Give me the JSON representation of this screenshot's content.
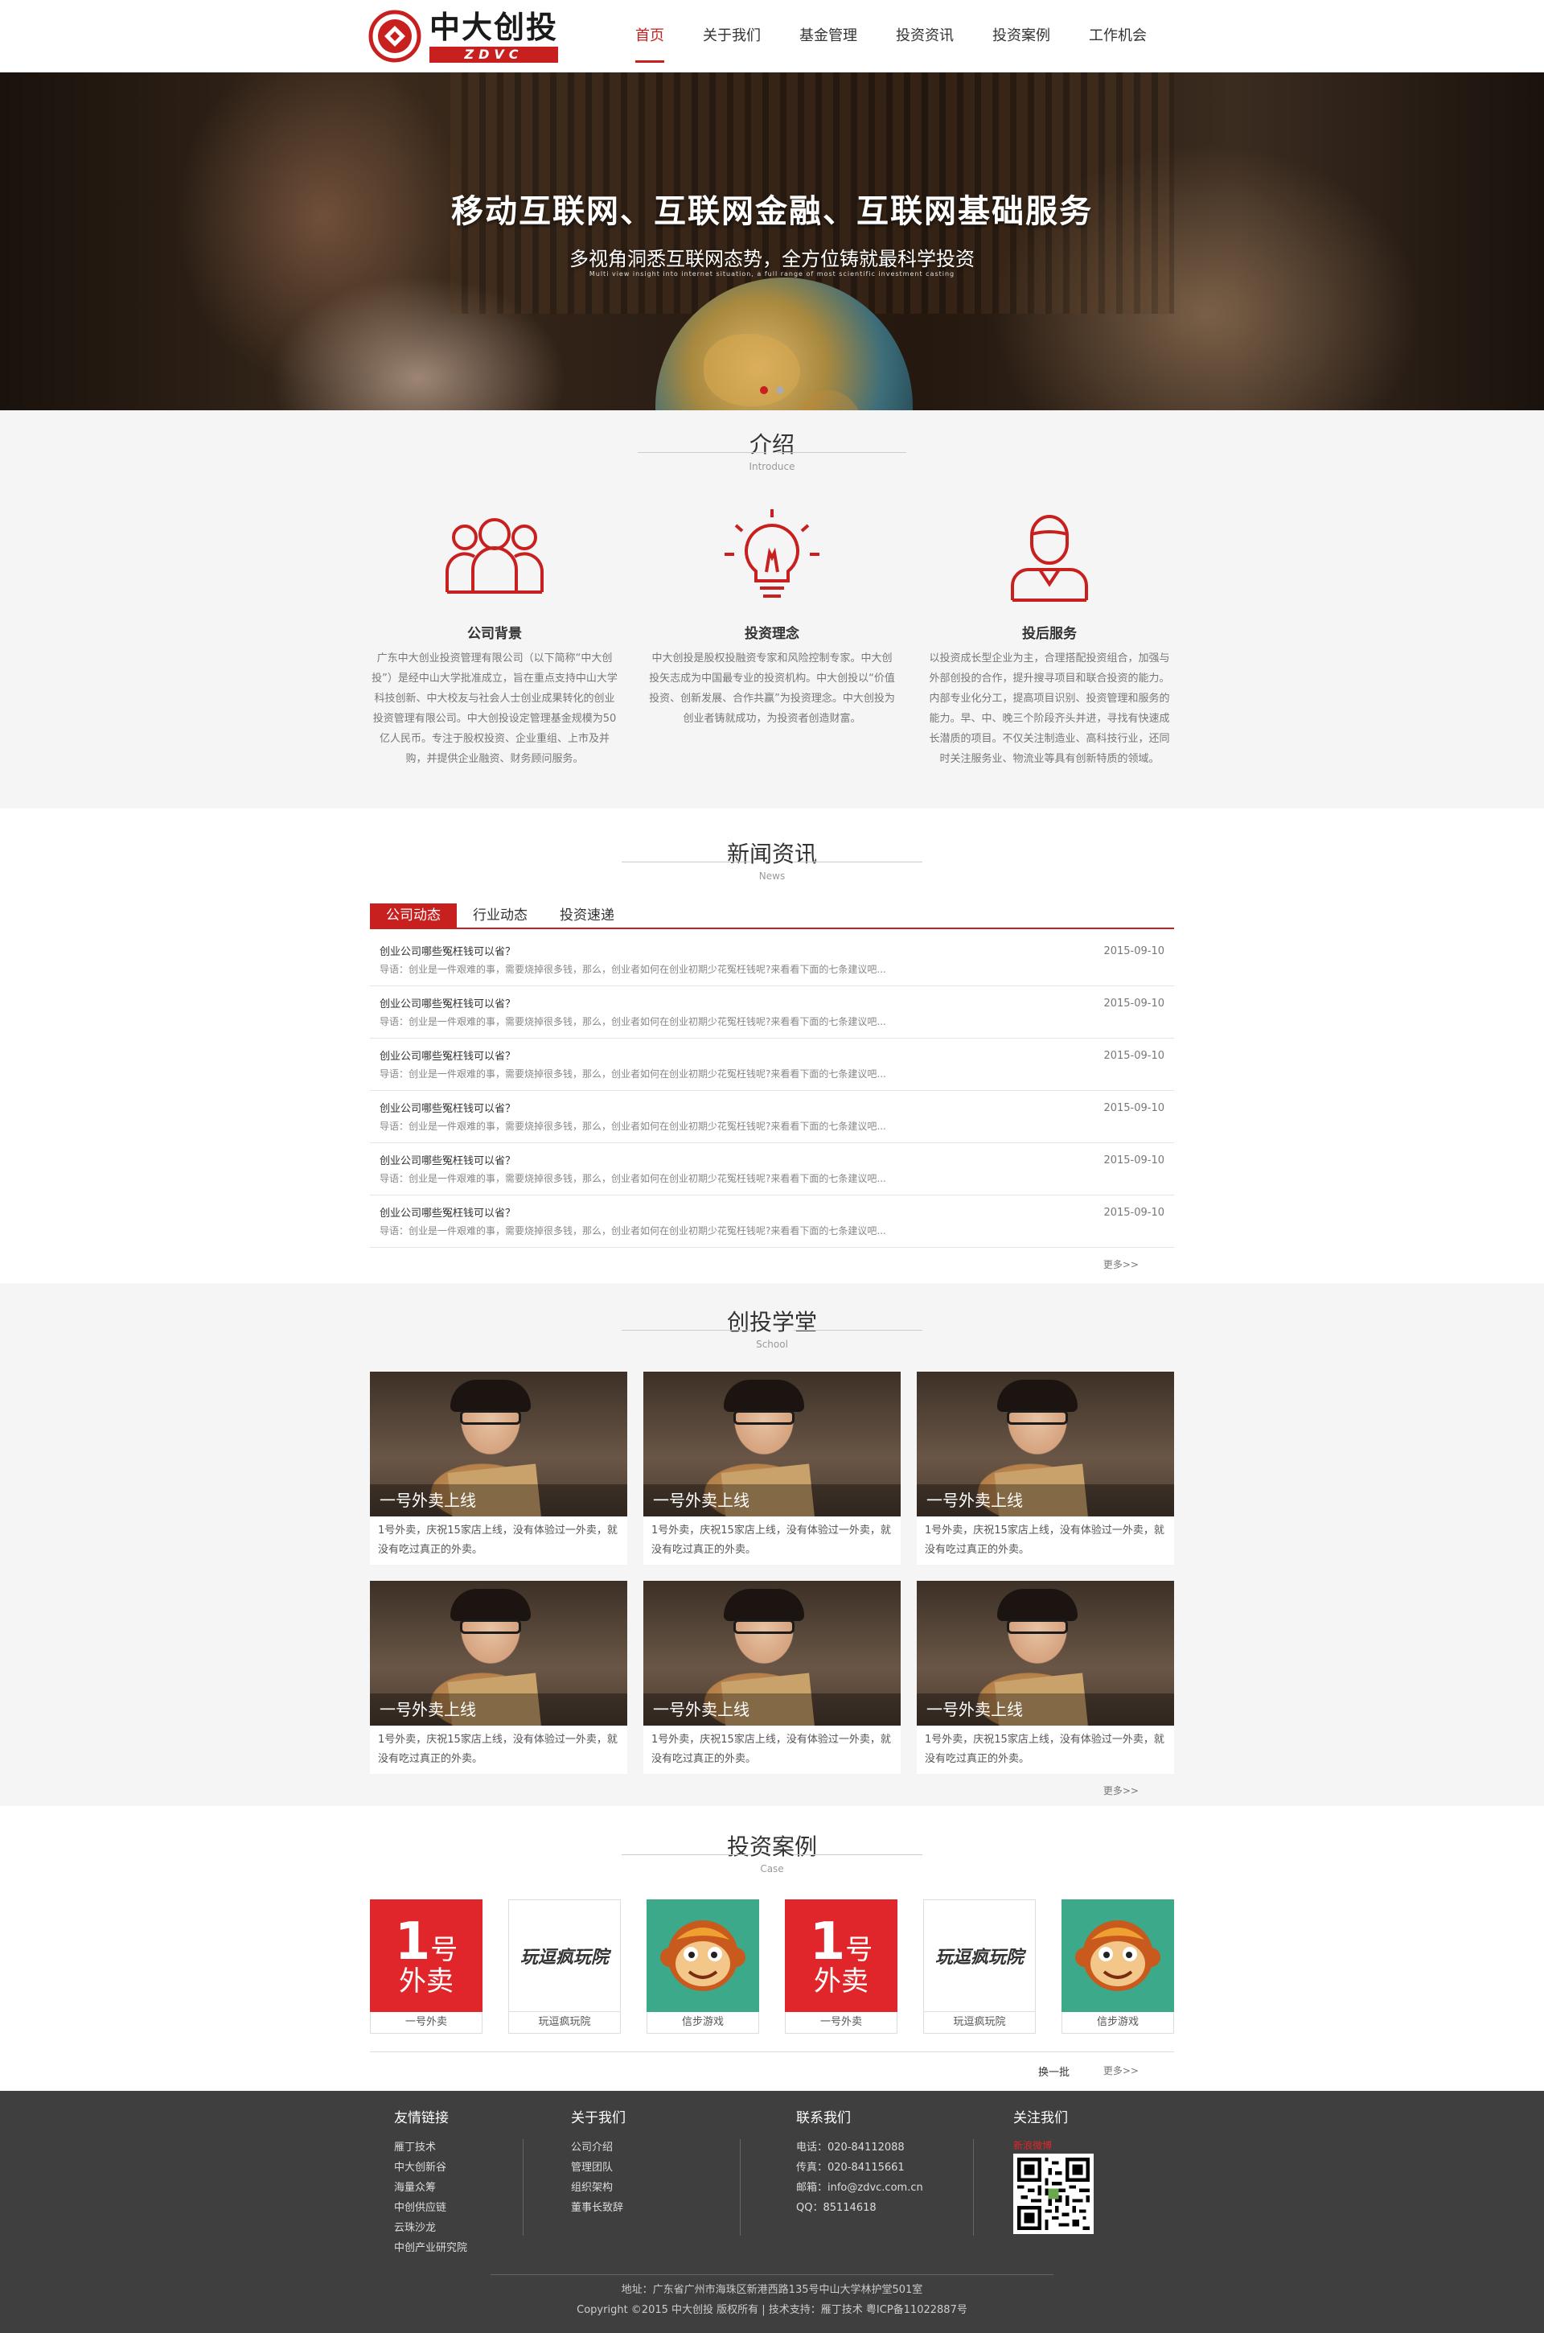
{
  "header": {
    "logo_cn": "中大创投",
    "logo_en": "ZDVC",
    "nav": [
      "首页",
      "关于我们",
      "基金管理",
      "投资资讯",
      "投资案例",
      "工作机会"
    ]
  },
  "banner": {
    "title": "移动互联网、互联网金融、互联网基础服务",
    "subtitle": "多视角洞悉互联网态势，全方位铸就最科学投资",
    "subtitle_en": "Multi view insight into internet situation, a full range of most scientific investment casting"
  },
  "intro": {
    "title": "介绍",
    "title_en": "Introduce",
    "cols": [
      {
        "icon": "people-icon",
        "heading": "公司背景",
        "text": "广东中大创业投资管理有限公司（以下简称“中大创投”）是经中山大学批准成立，旨在重点支持中山大学科技创新、中大校友与社会人士创业成果转化的创业投资管理有限公司。中大创投设定管理基金规模为50亿人民币。专注于股权投资、企业重组、上市及并购，并提供企业融资、财务顾问服务。"
      },
      {
        "icon": "lightbulb-icon",
        "heading": "投资理念",
        "text": "中大创投是股权投融资专家和风险控制专家。中大创投矢志成为中国最专业的投资机构。中大创投以“价值投资、创新发展、合作共赢”为投资理念。中大创投为创业者铸就成功，为投资者创造财富。"
      },
      {
        "icon": "person-icon",
        "heading": "投后服务",
        "text": "以投资成长型企业为主，合理搭配投资组合，加强与外部创投的合作，提升搜寻项目和联合投资的能力。内部专业化分工，提高项目识别、投资管理和服务的能力。早、中、晚三个阶段齐头并进，寻找有快速成长潜质的项目。不仅关注制造业、高科技行业，还同时关注服务业、物流业等具有创新特质的领域。"
      }
    ]
  },
  "news": {
    "title": "新闻资讯",
    "title_en": "News",
    "tabs": [
      "公司动态",
      "行业动态",
      "投资速递"
    ],
    "items": [
      {
        "title": "创业公司哪些冤枉钱可以省？",
        "desc": "导语：创业是一件艰难的事，需要烧掉很多钱，那么，创业者如何在创业初期少花冤枉钱呢?来看看下面的七条建议吧...",
        "date": "2015-09-10"
      },
      {
        "title": "创业公司哪些冤枉钱可以省？",
        "desc": "导语：创业是一件艰难的事，需要烧掉很多钱，那么，创业者如何在创业初期少花冤枉钱呢?来看看下面的七条建议吧...",
        "date": "2015-09-10"
      },
      {
        "title": "创业公司哪些冤枉钱可以省？",
        "desc": "导语：创业是一件艰难的事，需要烧掉很多钱，那么，创业者如何在创业初期少花冤枉钱呢?来看看下面的七条建议吧...",
        "date": "2015-09-10"
      },
      {
        "title": "创业公司哪些冤枉钱可以省？",
        "desc": "导语：创业是一件艰难的事，需要烧掉很多钱，那么，创业者如何在创业初期少花冤枉钱呢?来看看下面的七条建议吧...",
        "date": "2015-09-10"
      },
      {
        "title": "创业公司哪些冤枉钱可以省？",
        "desc": "导语：创业是一件艰难的事，需要烧掉很多钱，那么，创业者如何在创业初期少花冤枉钱呢?来看看下面的七条建议吧...",
        "date": "2015-09-10"
      },
      {
        "title": "创业公司哪些冤枉钱可以省？",
        "desc": "导语：创业是一件艰难的事，需要烧掉很多钱，那么，创业者如何在创业初期少花冤枉钱呢?来看看下面的七条建议吧...",
        "date": "2015-09-10"
      }
    ],
    "more": "更多>>"
  },
  "school": {
    "title": "创投学堂",
    "title_en": "School",
    "cards": [
      {
        "caption": "一号外卖上线",
        "desc": "1号外卖，庆祝15家店上线，没有体验过一外卖，就没有吃过真正的外卖。"
      },
      {
        "caption": "一号外卖上线",
        "desc": "1号外卖，庆祝15家店上线，没有体验过一外卖，就没有吃过真正的外卖。"
      },
      {
        "caption": "一号外卖上线",
        "desc": "1号外卖，庆祝15家店上线，没有体验过一外卖，就没有吃过真正的外卖。"
      },
      {
        "caption": "一号外卖上线",
        "desc": "1号外卖，庆祝15家店上线，没有体验过一外卖，就没有吃过真正的外卖。"
      },
      {
        "caption": "一号外卖上线",
        "desc": "1号外卖，庆祝15家店上线，没有体验过一外卖，就没有吃过真正的外卖。"
      },
      {
        "caption": "一号外卖上线",
        "desc": "1号外卖，庆祝15家店上线，没有体验过一外卖，就没有吃过真正的外卖。"
      }
    ],
    "more": "更多>>"
  },
  "case": {
    "title": "投资案例",
    "title_en": "Case",
    "items": [
      {
        "name": "一号外卖",
        "logo_big": "1",
        "logo_text1": "号",
        "logo_text2": "外卖"
      },
      {
        "name": "玩逗疯玩院",
        "logo_big": "",
        "logo_text1": "玩逗疯玩院",
        "logo_text2": ""
      },
      {
        "name": "信步游戏",
        "logo_big": "",
        "logo_text1": "",
        "logo_text2": ""
      },
      {
        "name": "一号外卖",
        "logo_big": "1",
        "logo_text1": "号",
        "logo_text2": "外卖"
      },
      {
        "name": "玩逗疯玩院",
        "logo_big": "",
        "logo_text1": "玩逗疯玩院",
        "logo_text2": ""
      },
      {
        "name": "信步游戏",
        "logo_big": "",
        "logo_text1": "",
        "logo_text2": ""
      }
    ],
    "swap": "换一批",
    "more": "更多>>"
  },
  "footer": {
    "links_title": "友情链接",
    "links": [
      "雁丁技术",
      "中大创新谷",
      "海量众筹",
      "中创供应链",
      "云珠沙龙",
      "中创产业研究院"
    ],
    "about_title": "关于我们",
    "about": [
      "公司介绍",
      "管理团队",
      "组织架构",
      "董事长致辞"
    ],
    "contact_title": "联系我们",
    "contact": [
      "电话：020-84112088",
      "传真：020-84115661",
      "邮箱：info@zdvc.com.cn",
      "QQ：85114618"
    ],
    "follow_title": "关注我们",
    "weibo": "新浪微博",
    "address": "地址：广东省广州市海珠区新港西路135号中山大学林护堂501室",
    "copyright": "Copyright ©2015 中大创投 版权所有  |  技术支持：雁丁技术    粤ICP备11022887号"
  },
  "colors": {
    "accent": "#c8201f",
    "footer_bg": "#3f3f3f",
    "section_bg": "#f5f5f5"
  }
}
